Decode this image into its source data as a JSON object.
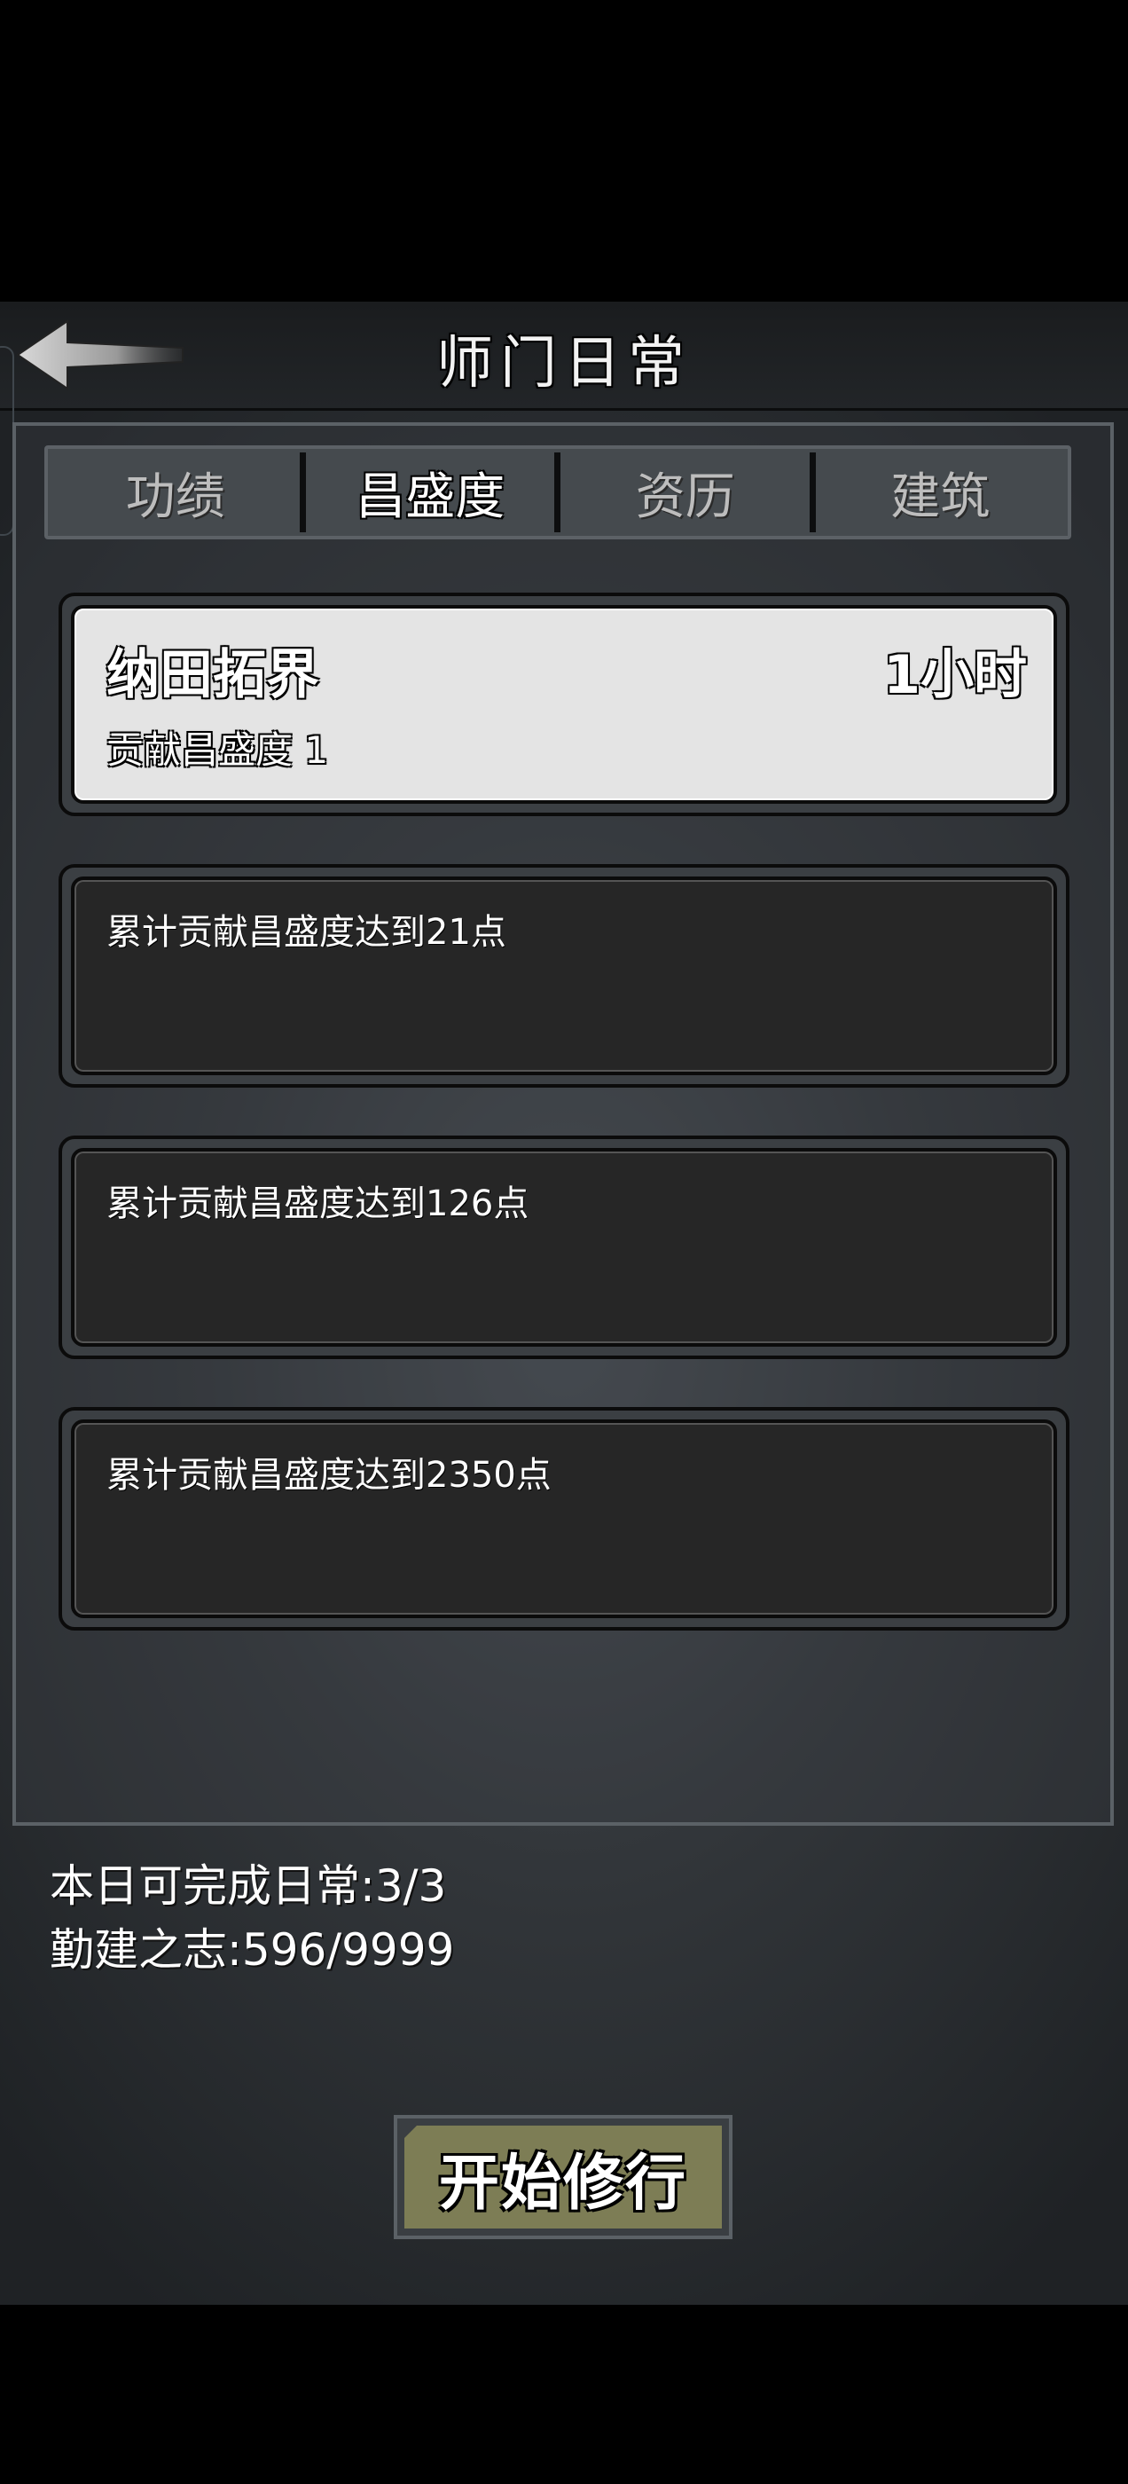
{
  "header": {
    "title": "师门日常"
  },
  "tabs": [
    {
      "label": "功绩"
    },
    {
      "label": "昌盛度"
    },
    {
      "label": "资历"
    },
    {
      "label": "建筑"
    }
  ],
  "active_tab": "昌盛度",
  "tasks": [
    {
      "title": "纳田拓界",
      "time": "1小时",
      "reward": "贡献昌盛度 1"
    },
    {
      "desc": "累计贡献昌盛度达到21点"
    },
    {
      "desc": "累计贡献昌盛度达到126点"
    },
    {
      "desc": "累计贡献昌盛度达到2350点"
    }
  ],
  "status": {
    "daily": "本日可完成日常:3/3",
    "diligence": "勤建之志:596/9999"
  },
  "start_button": {
    "label": "开始修行"
  },
  "colors": {
    "button_fill": "#7d7d55",
    "active_card": "#e4e4e4",
    "card_dark": "#262626"
  }
}
